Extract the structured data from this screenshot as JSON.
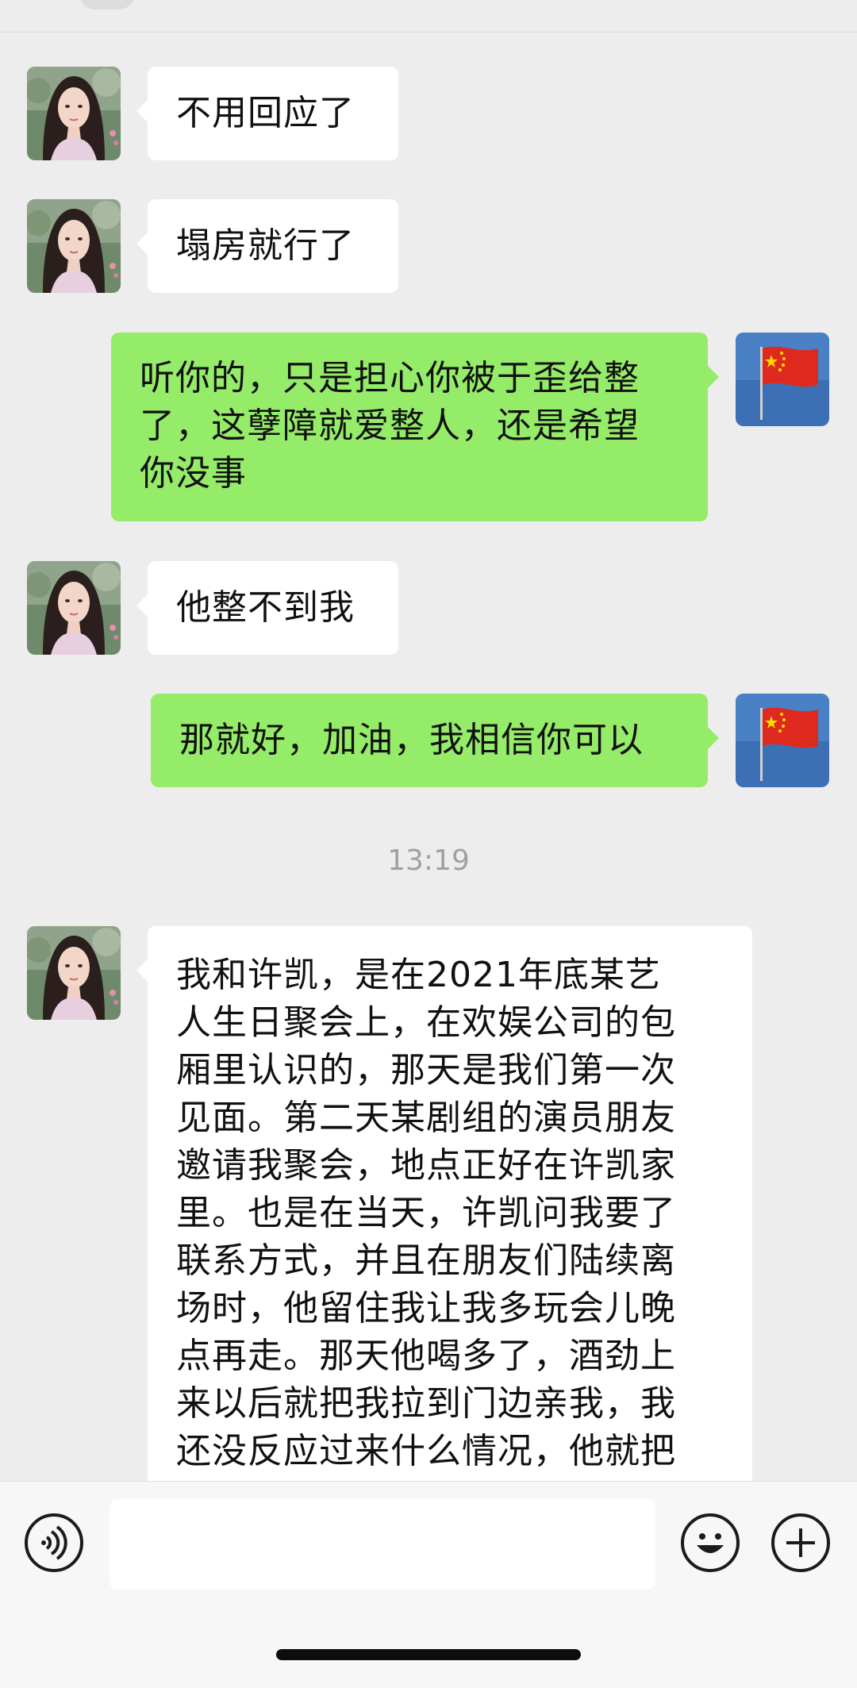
{
  "header": {
    "title": "",
    "back_icon": "back-icon"
  },
  "contacts": {
    "left_avatar": "woman-portrait-avatar",
    "right_avatar": "chinese-flag-avatar"
  },
  "colors": {
    "background": "#ededed",
    "incoming_bubble": "#ffffff",
    "outgoing_bubble": "#95ec69",
    "timestamp": "#a0a0a0"
  },
  "messages": [
    {
      "side": "in",
      "text": "不用回应了"
    },
    {
      "side": "in",
      "text": "塌房就行了"
    },
    {
      "side": "out",
      "lines": [
        "听你的，只是担心你被于歪给整",
        "了，这孽障就爱整人，还是希望",
        "你没事"
      ]
    },
    {
      "side": "in",
      "text": "他整不到我"
    },
    {
      "side": "out",
      "text": "那就好，加油，我相信你可以"
    },
    {
      "side": "in",
      "lines": [
        "我和许凯，是在2021年底某艺",
        "人生日聚会上，在欢娱公司的包",
        "厢里认识的，那天是我们第一次",
        "见面。第二天某剧组的演员朋友",
        "邀请我聚会，地点正好在许凯家",
        "里。也是在当天，许凯问我要了",
        "联系方式，并且在朋友们陆续离",
        "场时，他留住我让我多玩会儿晚",
        "点再走。那天他喝多了，酒劲上",
        "来以后就把我拉到门边亲我，我",
        "还没反应过来什么情况，他就把"
      ]
    }
  ],
  "timestamp": "13:19",
  "input_bar": {
    "voice_icon": "voice-icon",
    "emoji_icon": "emoji-icon",
    "plus_icon": "plus-icon",
    "input_value": ""
  }
}
